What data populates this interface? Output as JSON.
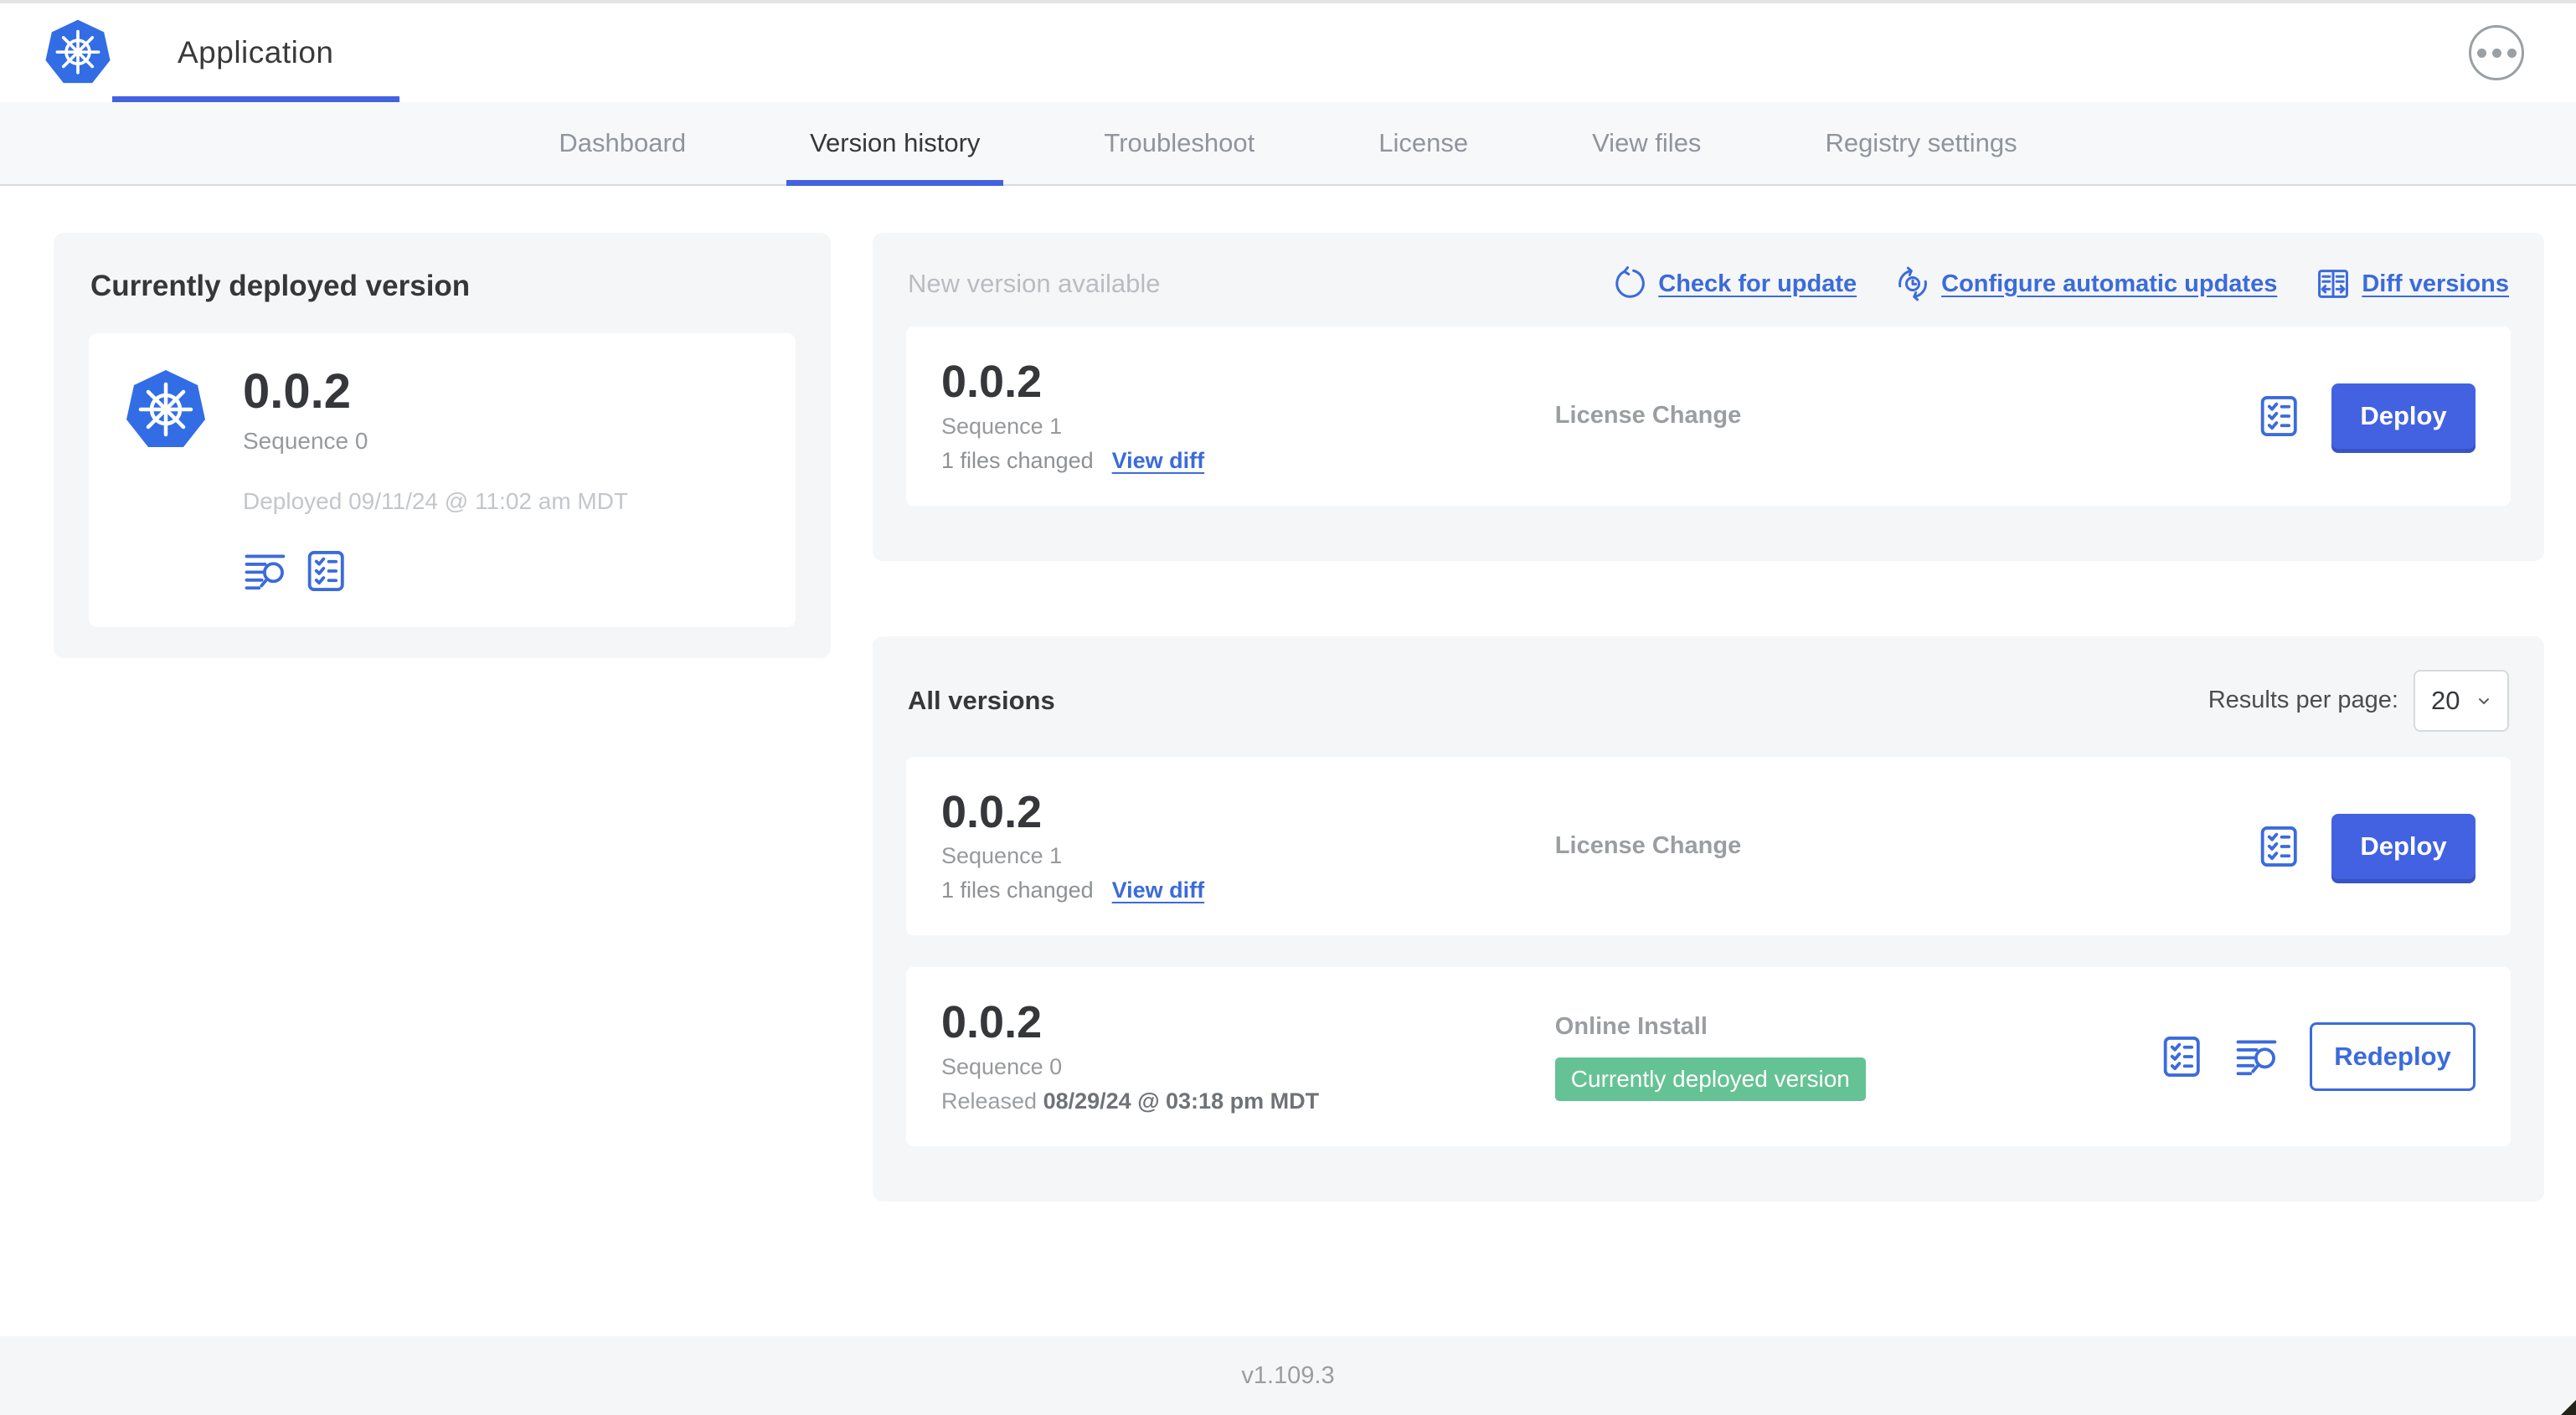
{
  "header": {
    "app_name": "Application",
    "menu_icon": "ellipsis-icon",
    "logo_icon": "kubernetes-logo-icon"
  },
  "nav": {
    "tabs": [
      {
        "label": "Dashboard",
        "active": false
      },
      {
        "label": "Version history",
        "active": true
      },
      {
        "label": "Troubleshoot",
        "active": false
      },
      {
        "label": "License",
        "active": false
      },
      {
        "label": "View files",
        "active": false
      },
      {
        "label": "Registry settings",
        "active": false
      }
    ]
  },
  "current": {
    "title": "Currently deployed version",
    "version": "0.0.2",
    "sequence": "Sequence 0",
    "deployed": "Deployed 09/11/24 @ 11:02 am MDT",
    "icons": [
      "logs-icon",
      "preflight-checklist-icon"
    ]
  },
  "new_version": {
    "title": "New version available",
    "actions": [
      {
        "label": "Check for update",
        "icon": "refresh-icon"
      },
      {
        "label": "Configure automatic updates",
        "icon": "schedule-update-icon"
      },
      {
        "label": "Diff versions",
        "icon": "diff-icon"
      }
    ],
    "card": {
      "version": "0.0.2",
      "sequence": "Sequence 1",
      "files_changed": "1 files changed",
      "view_diff_label": "View diff",
      "source": "License Change",
      "deploy_label": "Deploy"
    }
  },
  "all_versions": {
    "title": "All versions",
    "results_per_page_label": "Results per page:",
    "results_per_page_value": "20",
    "rows": [
      {
        "version": "0.0.2",
        "sequence": "Sequence 1",
        "files_changed": "1 files changed",
        "view_diff_label": "View diff",
        "source": "License Change",
        "action_label": "Deploy"
      },
      {
        "version": "0.0.2",
        "sequence": "Sequence 0",
        "released_prefix": "Released",
        "released_date": "08/29/24 @ 03:18 pm MDT",
        "source": "Online Install",
        "badge": "Currently deployed version",
        "action_label": "Redeploy"
      }
    ]
  },
  "footer": {
    "version": "v1.109.3"
  },
  "colors": {
    "primary_button_blue": "#4262e2",
    "link_blue": "#3b6bdb",
    "kubernetes_blue": "#326de6",
    "badge_green": "#65c294",
    "panel_gray": "#f5f6f8",
    "text_dark": "#35373b",
    "text_muted": "#9b9ea1",
    "text_light": "#c3c6ca"
  }
}
